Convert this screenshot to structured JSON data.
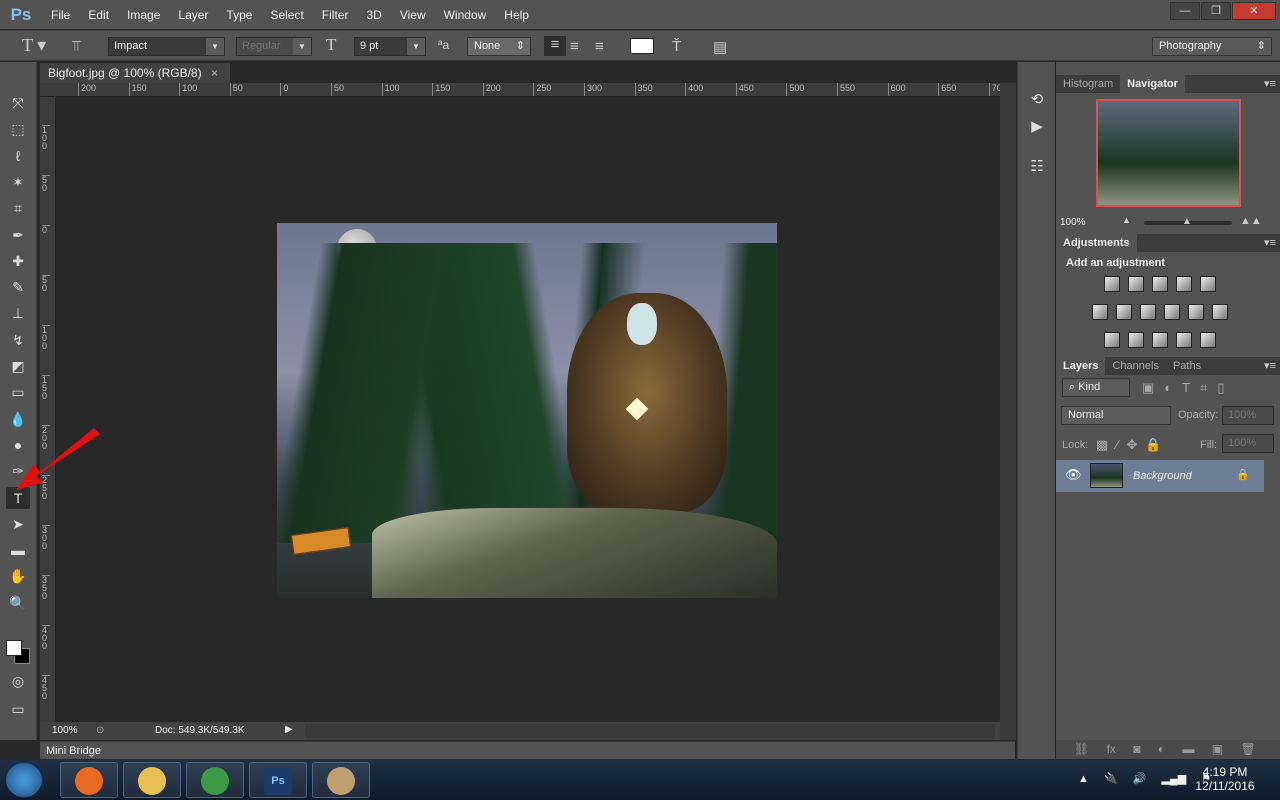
{
  "app": {
    "logo": "Ps",
    "menu": [
      "File",
      "Edit",
      "Image",
      "Layer",
      "Type",
      "Select",
      "Filter",
      "3D",
      "View",
      "Window",
      "Help"
    ],
    "window_buttons": [
      "minimize",
      "restore",
      "close"
    ]
  },
  "options": {
    "tool_icon": "type-icon",
    "font_family": "Impact",
    "font_style": "Regular",
    "font_size": "9 pt",
    "antialias": "None",
    "text_color": "#ffffff",
    "workspace": "Photography"
  },
  "tools": [
    "move",
    "marquee",
    "lasso",
    "magic-wand",
    "crop",
    "eyedropper",
    "healing",
    "brush",
    "clone-stamp",
    "history-brush",
    "eraser",
    "gradient",
    "blur",
    "dodge",
    "pen",
    "type",
    "path-selection",
    "rectangle",
    "hand",
    "zoom"
  ],
  "selected_tool": "type",
  "document": {
    "tab_title": "Bigfoot.jpg @ 100% (RGB/8)",
    "zoom": "100%",
    "doc_info": "Doc: 549.3K/549.3K"
  },
  "rulers": {
    "top": [
      "200",
      "150",
      "100",
      "50",
      "0",
      "50",
      "100",
      "150",
      "200",
      "250",
      "300",
      "350",
      "400",
      "450",
      "500",
      "550",
      "600",
      "650",
      "700"
    ],
    "left": [
      "100",
      "50",
      "0",
      "50",
      "100",
      "150",
      "200",
      "250",
      "300",
      "350",
      "400",
      "450"
    ]
  },
  "mini_bridge": "Mini Bridge",
  "panels": {
    "navigator": {
      "tabs": [
        "Histogram",
        "Navigator"
      ],
      "active": "Navigator",
      "zoom": "100%",
      "view_box_color": "#e05050"
    },
    "adjustments": {
      "tab": "Adjustments",
      "heading": "Add an adjustment"
    },
    "layers": {
      "tabs": [
        "Layers",
        "Channels",
        "Paths"
      ],
      "active": "Layers",
      "filter": "Kind",
      "blend_mode": "Normal",
      "opacity_label": "Opacity:",
      "opacity": "100%",
      "lock_label": "Lock:",
      "fill_label": "Fill:",
      "fill": "100%",
      "layers": [
        {
          "name": "Background",
          "visible": true,
          "locked": true
        }
      ]
    }
  },
  "taskbar": {
    "apps": [
      "Firefox",
      "File Explorer",
      "Chrome",
      "Photoshop",
      "Paint"
    ],
    "time": "4:19 PM",
    "date": "12/11/2016"
  },
  "annotation": {
    "arrow_color": "#e01010"
  }
}
